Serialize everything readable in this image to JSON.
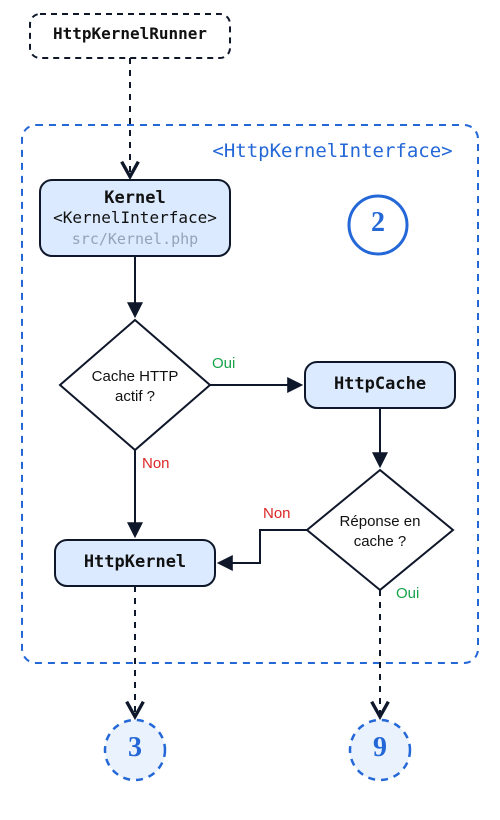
{
  "nodes": {
    "runner": {
      "label": "HttpKernelRunner"
    },
    "interfaceBox": {
      "label": "<HttpKernelInterface>"
    },
    "kernel": {
      "title": "Kernel",
      "subtitle": "<KernelInterface>",
      "path": "src/Kernel.php"
    },
    "badge2": {
      "label": "2"
    },
    "decisionCache": {
      "label_line1": "Cache HTTP",
      "label_line2": "actif ?"
    },
    "httpCache": {
      "label": "HttpCache"
    },
    "decisionResp": {
      "label_line1": "Réponse en",
      "label_line2": "cache ?"
    },
    "httpKernel": {
      "label": "HttpKernel"
    },
    "badge3": {
      "label": "3"
    },
    "badge9": {
      "label": "9"
    }
  },
  "edges": {
    "cache_yes": {
      "label": "Oui"
    },
    "cache_no": {
      "label": "Non"
    },
    "resp_yes": {
      "label": "Oui"
    },
    "resp_no": {
      "label": "Non"
    }
  },
  "colors": {
    "dashed": "#0f172a",
    "blue": "#2468d8",
    "lightBlue": "#dbeafe",
    "lightBlueSoft": "#eaf2fd",
    "green": "#16a34a",
    "red": "#dc2626",
    "grey": "#94a3b8",
    "black": "#0f172a"
  }
}
